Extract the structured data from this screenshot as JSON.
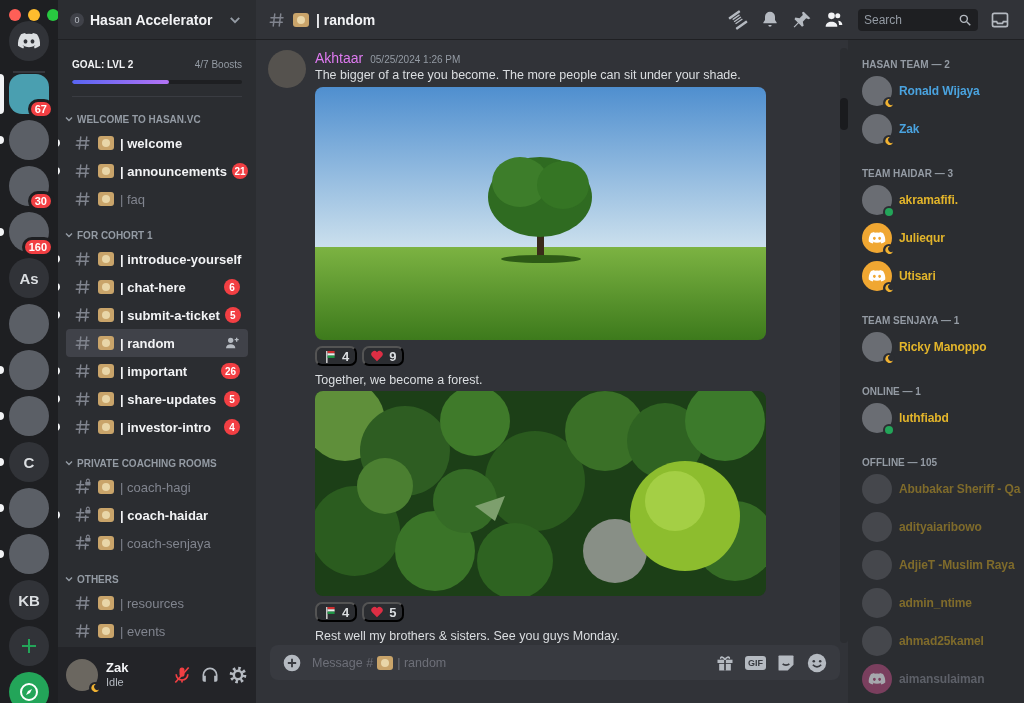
{
  "servers": [
    {
      "kind": "home",
      "selected": false,
      "unread": false
    },
    {
      "kind": "photo",
      "selected": true,
      "unread": false,
      "badge": "67"
    },
    {
      "kind": "photo",
      "selected": false,
      "unread": true
    },
    {
      "kind": "photo",
      "selected": false,
      "unread": false,
      "badge": "30"
    },
    {
      "kind": "photo",
      "selected": false,
      "unread": true,
      "badge": "160"
    },
    {
      "kind": "initials",
      "initials": "As",
      "selected": false,
      "unread": false
    },
    {
      "kind": "photo",
      "selected": false,
      "unread": false
    },
    {
      "kind": "photo",
      "selected": false,
      "unread": true
    },
    {
      "kind": "photo",
      "selected": false,
      "unread": true
    },
    {
      "kind": "initials",
      "initials": "C",
      "selected": false,
      "unread": true
    },
    {
      "kind": "photo",
      "selected": false,
      "unread": true
    },
    {
      "kind": "photo",
      "selected": false,
      "unread": true
    },
    {
      "kind": "initials",
      "initials": "KB",
      "selected": false,
      "unread": false
    },
    {
      "kind": "add",
      "selected": false,
      "unread": false
    },
    {
      "kind": "explore",
      "selected": false,
      "unread": false
    }
  ],
  "server": {
    "badge": "0",
    "name": "Hasan Accelerator"
  },
  "boost": {
    "goal": "GOAL: LVL 2",
    "progress": "4/7 Boosts",
    "level": 0.57
  },
  "categories": [
    {
      "name": "WELCOME TO HASAN.VC",
      "expanded": true,
      "channels": [
        {
          "kind": "text",
          "label": "| welcome",
          "unread": true,
          "selected": false
        },
        {
          "kind": "text",
          "label": "| announcements",
          "unread": true,
          "selected": false,
          "badge": "21"
        },
        {
          "kind": "text",
          "label": "| faq",
          "unread": false,
          "selected": false
        }
      ]
    },
    {
      "name": "FOR COHORT 1",
      "expanded": true,
      "channels": [
        {
          "kind": "text",
          "label": "| introduce-yourself",
          "unread": true,
          "selected": false
        },
        {
          "kind": "text",
          "label": "| chat-here",
          "unread": true,
          "selected": false,
          "badge": "6"
        },
        {
          "kind": "text",
          "label": "| submit-a-ticket",
          "unread": true,
          "selected": false,
          "badge": "5"
        },
        {
          "kind": "text",
          "label": "| random",
          "unread": false,
          "selected": true
        },
        {
          "kind": "text",
          "label": "| important",
          "unread": true,
          "selected": false,
          "badge": "26"
        },
        {
          "kind": "text",
          "label": "| share-updates",
          "unread": true,
          "selected": false,
          "badge": "5"
        },
        {
          "kind": "text",
          "label": "| investor-intro",
          "unread": true,
          "selected": false,
          "badge": "4"
        }
      ]
    },
    {
      "name": "PRIVATE COACHING ROOMS",
      "expanded": true,
      "channels": [
        {
          "kind": "private",
          "label": "| coach-hagi",
          "unread": false,
          "selected": false
        },
        {
          "kind": "private",
          "label": "| coach-haidar",
          "unread": true,
          "selected": false
        },
        {
          "kind": "private",
          "label": "| coach-senjaya",
          "unread": false,
          "selected": false
        }
      ]
    },
    {
      "name": "OTHERS",
      "expanded": true,
      "channels": [
        {
          "kind": "text",
          "label": "| resources",
          "unread": false,
          "selected": false
        },
        {
          "kind": "text",
          "label": "| events",
          "unread": false,
          "selected": false
        }
      ]
    }
  ],
  "user": {
    "name": "Zak",
    "status": "Idle",
    "muted": true
  },
  "header": {
    "channel": "| random",
    "search": {
      "placeholder": "Search"
    }
  },
  "messages": [
    {
      "author": "Akhtaar",
      "timestamp": "05/25/2024 1:26 PM",
      "blocks": [
        {
          "kind": "text",
          "text": "The bigger of a tree you become. The more people can sit under your shade."
        },
        {
          "kind": "tree_photo"
        },
        {
          "kind": "reactions",
          "reactions": [
            {
              "kind": "flag",
              "count": "4"
            },
            {
              "kind": "heart",
              "count": "9"
            }
          ]
        },
        {
          "kind": "text",
          "text": "Together, we become a forest."
        },
        {
          "kind": "forest_photo"
        },
        {
          "kind": "reactions",
          "reactions": [
            {
              "kind": "flag",
              "count": "4"
            },
            {
              "kind": "heart",
              "count": "5"
            }
          ]
        },
        {
          "kind": "text",
          "text": "Rest well my brothers & sisters. See you guys Monday."
        }
      ]
    }
  ],
  "composer": {
    "hint_prefix": "Message #",
    "hint_channel": "| random",
    "gif_label": "GIF"
  },
  "member_groups": [
    {
      "title": "HASAN TEAM — 2",
      "members": [
        {
          "name": "Ronald Wijaya",
          "color": "#4aa3df",
          "idle": true,
          "online": true,
          "avatar": {
            "kind": "photo"
          }
        },
        {
          "name": "Zak",
          "color": "#4aa3df",
          "idle": true,
          "online": true,
          "avatar": {
            "kind": "photo"
          }
        }
      ]
    },
    {
      "title": "TEAM HAIDAR — 3",
      "members": [
        {
          "name": "akramafifi.",
          "color": "#e3b52b",
          "idle": false,
          "online": true,
          "avatar": {
            "kind": "photo"
          }
        },
        {
          "name": "Juliequr",
          "color": "#e3b52b",
          "idle": true,
          "online": true,
          "avatar": {
            "kind": "logo",
            "color": "#f0a732"
          }
        },
        {
          "name": "Utisari",
          "color": "#e3b52b",
          "idle": true,
          "online": true,
          "avatar": {
            "kind": "logo",
            "color": "#f0a732"
          }
        }
      ]
    },
    {
      "title": "TEAM SENJAYA — 1",
      "members": [
        {
          "name": "Ricky Manoppo",
          "color": "#e3b52b",
          "idle": true,
          "online": true,
          "avatar": {
            "kind": "photo"
          }
        }
      ]
    },
    {
      "title": "ONLINE — 1",
      "members": [
        {
          "name": "luthfiabd",
          "color": "#e3b52b",
          "idle": false,
          "online": true,
          "avatar": {
            "kind": "photo"
          }
        }
      ]
    },
    {
      "title": "OFFLINE — 105",
      "members": [
        {
          "name": "Abubakar Sheriff - Qa",
          "color": "#7f6b2b",
          "idle": false,
          "online": false,
          "avatar": {
            "kind": "photo"
          }
        },
        {
          "name": "adityaiaribowo",
          "color": "#7f6b2b",
          "idle": false,
          "online": false,
          "avatar": {
            "kind": "photo"
          }
        },
        {
          "name": "AdjieT -Muslim Raya",
          "color": "#7f6b2b",
          "idle": false,
          "online": false,
          "avatar": {
            "kind": "photo"
          }
        },
        {
          "name": "admin_ntime",
          "color": "#7f6b2b",
          "idle": false,
          "online": false,
          "avatar": {
            "kind": "photo"
          }
        },
        {
          "name": "ahmad25kamel",
          "color": "#7f6b2b",
          "idle": false,
          "online": false,
          "avatar": {
            "kind": "photo"
          }
        },
        {
          "name": "aimansulaiman",
          "color": "#5d6068",
          "idle": false,
          "online": false,
          "avatar": {
            "kind": "logo",
            "color": "#7a3f5e"
          }
        }
      ]
    }
  ]
}
